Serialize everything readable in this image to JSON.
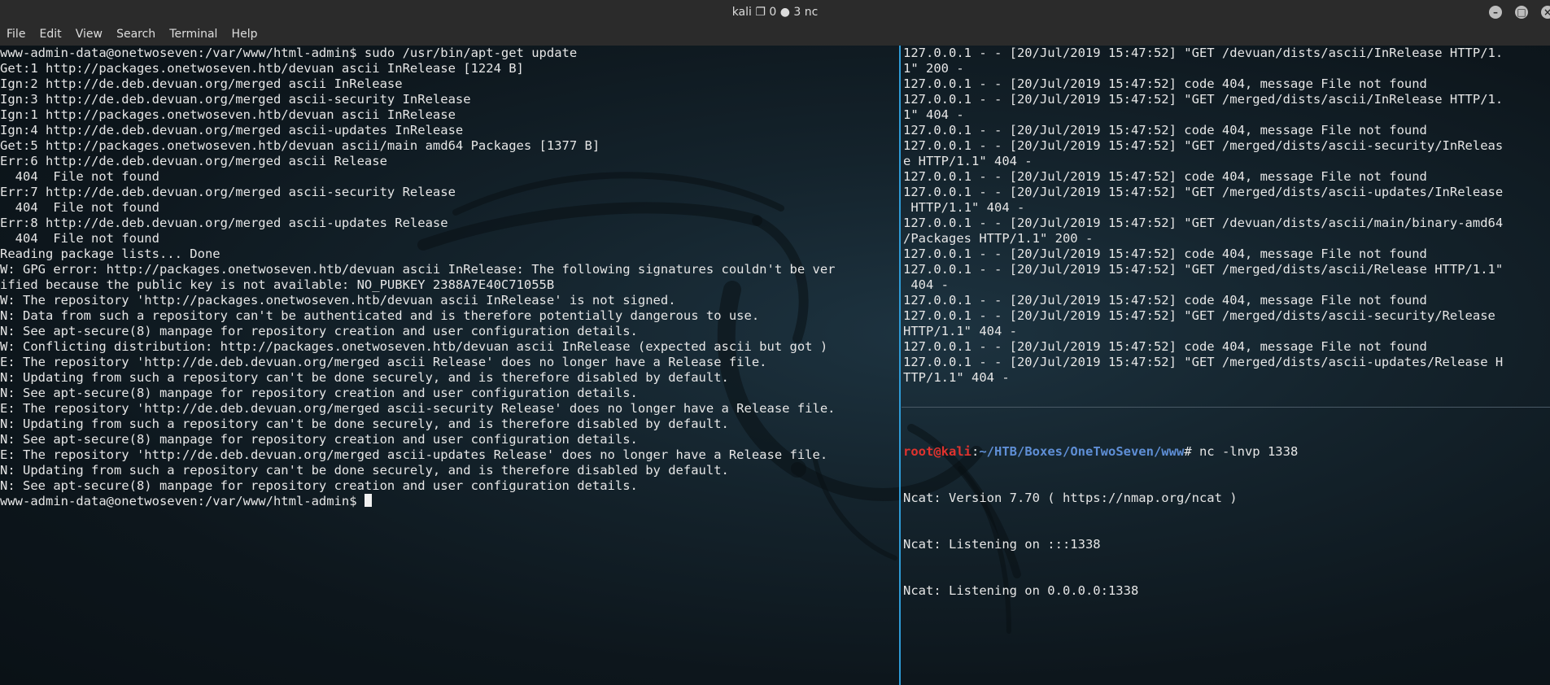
{
  "window": {
    "title": "kali ❐ 0 ● 3 nc",
    "min_icon": "minimize-icon",
    "max_icon": "maximize-icon",
    "close_icon": "close-icon"
  },
  "menu": [
    "File",
    "Edit",
    "View",
    "Search",
    "Terminal",
    "Help"
  ],
  "left_pane": {
    "lines": [
      "www-admin-data@onetwoseven:/var/www/html-admin$ sudo /usr/bin/apt-get update",
      "Get:1 http://packages.onetwoseven.htb/devuan ascii InRelease [1224 B]",
      "Ign:2 http://de.deb.devuan.org/merged ascii InRelease",
      "Ign:3 http://de.deb.devuan.org/merged ascii-security InRelease",
      "Ign:1 http://packages.onetwoseven.htb/devuan ascii InRelease",
      "Ign:4 http://de.deb.devuan.org/merged ascii-updates InRelease",
      "Get:5 http://packages.onetwoseven.htb/devuan ascii/main amd64 Packages [1377 B]",
      "Err:6 http://de.deb.devuan.org/merged ascii Release",
      "  404  File not found",
      "Err:7 http://de.deb.devuan.org/merged ascii-security Release",
      "  404  File not found",
      "Err:8 http://de.deb.devuan.org/merged ascii-updates Release",
      "  404  File not found",
      "Reading package lists... Done",
      "W: GPG error: http://packages.onetwoseven.htb/devuan ascii InRelease: The following signatures couldn't be ver",
      "ified because the public key is not available: NO_PUBKEY 2388A7E40C71055B",
      "W: The repository 'http://packages.onetwoseven.htb/devuan ascii InRelease' is not signed.",
      "N: Data from such a repository can't be authenticated and is therefore potentially dangerous to use.",
      "N: See apt-secure(8) manpage for repository creation and user configuration details.",
      "W: Conflicting distribution: http://packages.onetwoseven.htb/devuan ascii InRelease (expected ascii but got )",
      "E: The repository 'http://de.deb.devuan.org/merged ascii Release' does no longer have a Release file.",
      "N: Updating from such a repository can't be done securely, and is therefore disabled by default.",
      "N: See apt-secure(8) manpage for repository creation and user configuration details.",
      "E: The repository 'http://de.deb.devuan.org/merged ascii-security Release' does no longer have a Release file.",
      "N: Updating from such a repository can't be done securely, and is therefore disabled by default.",
      "N: See apt-secure(8) manpage for repository creation and user configuration details.",
      "E: The repository 'http://de.deb.devuan.org/merged ascii-updates Release' does no longer have a Release file.",
      "N: Updating from such a repository can't be done securely, and is therefore disabled by default.",
      "N: See apt-secure(8) manpage for repository creation and user configuration details."
    ],
    "prompt": "www-admin-data@onetwoseven:/var/www/html-admin$ "
  },
  "right_top_pane": {
    "lines": [
      "127.0.0.1 - - [20/Jul/2019 15:47:52] \"GET /devuan/dists/ascii/InRelease HTTP/1.",
      "1\" 200 -",
      "127.0.0.1 - - [20/Jul/2019 15:47:52] code 404, message File not found",
      "127.0.0.1 - - [20/Jul/2019 15:47:52] \"GET /merged/dists/ascii/InRelease HTTP/1.",
      "1\" 404 -",
      "127.0.0.1 - - [20/Jul/2019 15:47:52] code 404, message File not found",
      "127.0.0.1 - - [20/Jul/2019 15:47:52] \"GET /merged/dists/ascii-security/InReleas",
      "e HTTP/1.1\" 404 -",
      "127.0.0.1 - - [20/Jul/2019 15:47:52] code 404, message File not found",
      "127.0.0.1 - - [20/Jul/2019 15:47:52] \"GET /merged/dists/ascii-updates/InRelease",
      " HTTP/1.1\" 404 -",
      "127.0.0.1 - - [20/Jul/2019 15:47:52] \"GET /devuan/dists/ascii/main/binary-amd64",
      "/Packages HTTP/1.1\" 200 -",
      "127.0.0.1 - - [20/Jul/2019 15:47:52] code 404, message File not found",
      "127.0.0.1 - - [20/Jul/2019 15:47:52] \"GET /merged/dists/ascii/Release HTTP/1.1\"",
      " 404 -",
      "127.0.0.1 - - [20/Jul/2019 15:47:52] code 404, message File not found",
      "127.0.0.1 - - [20/Jul/2019 15:47:52] \"GET /merged/dists/ascii-security/Release",
      "HTTP/1.1\" 404 -",
      "127.0.0.1 - - [20/Jul/2019 15:47:52] code 404, message File not found",
      "127.0.0.1 - - [20/Jul/2019 15:47:52] \"GET /merged/dists/ascii-updates/Release H",
      "TTP/1.1\" 404 -"
    ]
  },
  "right_bottom_pane": {
    "prompt_user": "root@kali",
    "prompt_sep": ":",
    "prompt_path": "~/HTB/Boxes/OneTwoSeven/www",
    "prompt_cmd": "# nc -lnvp 1338",
    "lines": [
      "Ncat: Version 7.70 ( https://nmap.org/ncat )",
      "Ncat: Listening on :::1338",
      "Ncat: Listening on 0.0.0.0:1338"
    ]
  }
}
